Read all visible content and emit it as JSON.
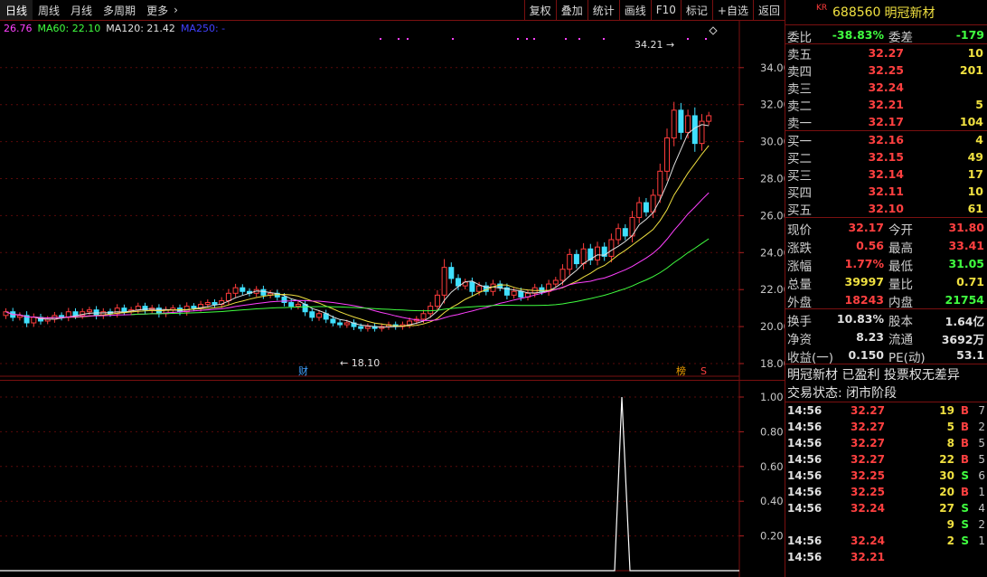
{
  "toolbar": {
    "periods": [
      "日线",
      "周线",
      "月线",
      "多周期",
      "更多"
    ],
    "more_icon": "chevron-right-icon",
    "actions": [
      "复权",
      "叠加",
      "统计",
      "画线",
      "F10",
      "标记",
      "+自选",
      "返回"
    ]
  },
  "ma_legend": [
    {
      "label": "26.76",
      "color": "#ff40ff"
    },
    {
      "label": "MA60: 22.10",
      "color": "#40ff40"
    },
    {
      "label": "MA120: 21.42",
      "color": "#e0e0e0"
    },
    {
      "label": "MA250: -",
      "color": "#4040ff"
    }
  ],
  "main_chart": {
    "y_ticks": [
      "34.00",
      "32.00",
      "30.00",
      "28.00",
      "26.00",
      "24.00",
      "22.00",
      "20.00",
      "18.00"
    ],
    "high_label": "34.21",
    "low_label": "18.10",
    "markers": {
      "cai": "财",
      "bang": "榜",
      "s": "S"
    }
  },
  "indicator_chart": {
    "y_ticks": [
      "1.00",
      "0.80",
      "0.60",
      "0.40",
      "0.20"
    ]
  },
  "quote": {
    "badge": "KR",
    "code": "688560",
    "name": "明冠新材",
    "weibi_label": "委比",
    "weibi_value": "-38.83%",
    "weicha_label": "委差",
    "weicha_value": "-179",
    "asks": [
      {
        "label": "卖五",
        "price": "32.27",
        "vol": "10"
      },
      {
        "label": "卖四",
        "price": "32.25",
        "vol": "201"
      },
      {
        "label": "卖三",
        "price": "32.24",
        "vol": ""
      },
      {
        "label": "卖二",
        "price": "32.21",
        "vol": "5"
      },
      {
        "label": "卖一",
        "price": "32.17",
        "vol": "104"
      }
    ],
    "bids": [
      {
        "label": "买一",
        "price": "32.16",
        "vol": "4"
      },
      {
        "label": "买二",
        "price": "32.15",
        "vol": "49"
      },
      {
        "label": "买三",
        "price": "32.14",
        "vol": "17"
      },
      {
        "label": "买四",
        "price": "32.11",
        "vol": "10"
      },
      {
        "label": "买五",
        "price": "32.10",
        "vol": "61"
      }
    ],
    "stats": [
      {
        "l1": "现价",
        "v1": "32.17",
        "c1": "#ff4040",
        "l2": "今开",
        "v2": "31.80",
        "c2": "#ff4040"
      },
      {
        "l1": "涨跌",
        "v1": "0.56",
        "c1": "#ff4040",
        "l2": "最高",
        "v2": "33.41",
        "c2": "#ff4040"
      },
      {
        "l1": "涨幅",
        "v1": "1.77%",
        "c1": "#ff4040",
        "l2": "最低",
        "v2": "31.05",
        "c2": "#40ff40"
      },
      {
        "l1": "总量",
        "v1": "39997",
        "c1": "#f0e040",
        "l2": "量比",
        "v2": "0.71",
        "c2": "#f0e040"
      },
      {
        "l1": "外盘",
        "v1": "18243",
        "c1": "#ff4040",
        "l2": "内盘",
        "v2": "21754",
        "c2": "#40ff40"
      }
    ],
    "stats2": [
      {
        "l1": "换手",
        "v1": "10.83%",
        "c1": "#e0e0e0",
        "l2": "股本",
        "v2": "1.64亿",
        "c2": "#e0e0e0"
      },
      {
        "l1": "净资",
        "v1": "8.23",
        "c1": "#e0e0e0",
        "l2": "流通",
        "v2": "3692万",
        "c2": "#e0e0e0"
      },
      {
        "l1": "收益(一)",
        "v1": "0.150",
        "c1": "#e0e0e0",
        "l2": "PE(动)",
        "v2": "53.1",
        "c2": "#e0e0e0"
      }
    ],
    "info_line": "明冠新材 已盈利 投票权无差异",
    "status_line": "交易状态: 闭市阶段",
    "ticks": [
      {
        "t": "14:56",
        "p": "32.27",
        "v": "19",
        "d": "B",
        "n": "7"
      },
      {
        "t": "14:56",
        "p": "32.27",
        "v": "5",
        "d": "B",
        "n": "2"
      },
      {
        "t": "14:56",
        "p": "32.27",
        "v": "8",
        "d": "B",
        "n": "5"
      },
      {
        "t": "14:56",
        "p": "32.27",
        "v": "22",
        "d": "B",
        "n": "5"
      },
      {
        "t": "14:56",
        "p": "32.25",
        "v": "30",
        "d": "S",
        "n": "6"
      },
      {
        "t": "14:56",
        "p": "32.25",
        "v": "20",
        "d": "B",
        "n": "1"
      },
      {
        "t": "14:56",
        "p": "32.24",
        "v": "27",
        "d": "S",
        "n": "4"
      },
      {
        "t": "",
        "p": "",
        "v": "9",
        "d": "S",
        "n": "2"
      },
      {
        "t": "14:56",
        "p": "32.24",
        "v": "2",
        "d": "S",
        "n": "1"
      },
      {
        "t": "14:56",
        "p": "32.21",
        "v": "",
        "d": "",
        "n": ""
      }
    ]
  }
}
